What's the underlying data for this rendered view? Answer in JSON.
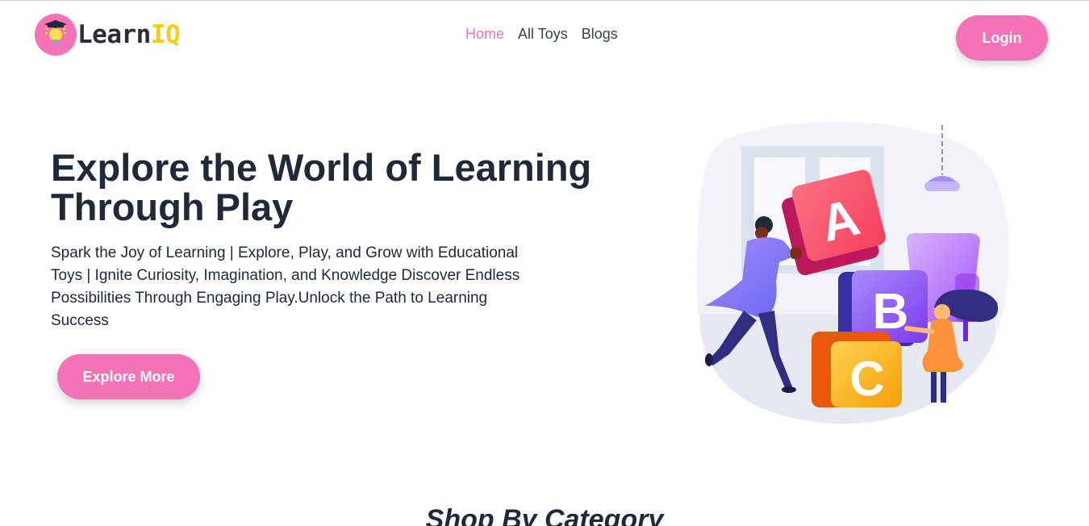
{
  "brand": {
    "name_part1": "Learn",
    "name_part2": "IQ"
  },
  "nav": {
    "items": [
      {
        "label": "Home",
        "active": true
      },
      {
        "label": "All Toys",
        "active": false
      },
      {
        "label": "Blogs",
        "active": false
      }
    ]
  },
  "header": {
    "login_label": "Login"
  },
  "hero": {
    "title": "Explore the World of Learning Through Play",
    "subtitle": "Spark the Joy of Learning | Explore, Play, and Grow with Educational Toys | Ignite Curiosity, Imagination, and Knowledge Discover Endless Possibilities Through Engaging Play.Unlock the Path to Learning Success",
    "cta_label": "Explore More",
    "illustration_blocks": [
      "A",
      "B",
      "C"
    ]
  },
  "section": {
    "title": "Shop By Category"
  },
  "colors": {
    "accent": "#f472b6",
    "brand_yellow": "#facc15",
    "text_dark": "#1f2937"
  }
}
